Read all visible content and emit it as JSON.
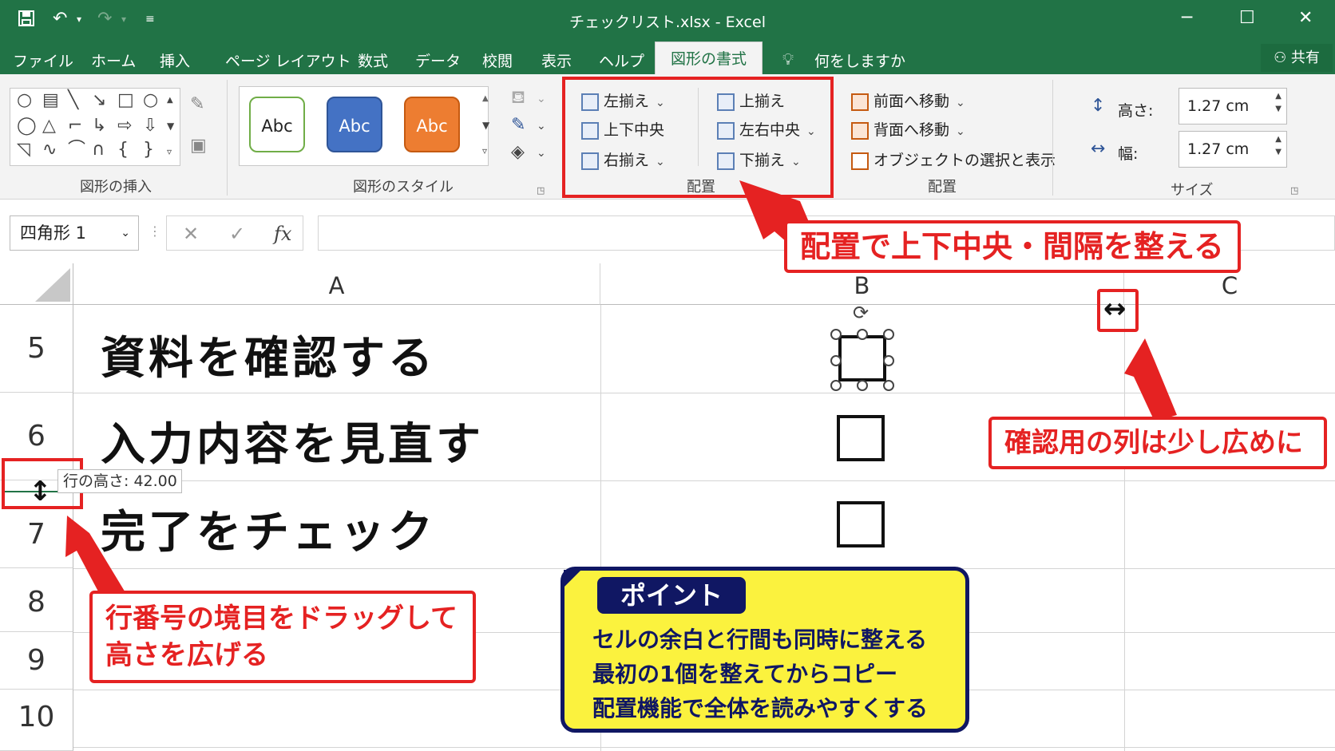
{
  "window": {
    "title": "チェックリスト.xlsx  -  Excel"
  },
  "titlebar": {
    "save_icon": "save-icon",
    "undo_icon": "undo-icon",
    "redo_icon": "redo-icon",
    "minimize": "─",
    "restore": "☐",
    "close": "✕"
  },
  "menu": {
    "items": [
      "ファイル",
      "ホーム",
      "挿入",
      "ページ レイアウト",
      "数式",
      "データ",
      "校閲",
      "表示",
      "ヘルプ"
    ],
    "active": "図形の書式",
    "search": "何をしますか",
    "share": "共有"
  },
  "ribbon": {
    "insert_shapes_label": "図形の挿入",
    "shape_styles_label": "図形のスタイル",
    "style_samples": [
      "Abc",
      "Abc",
      "Abc"
    ],
    "align": {
      "left": "左揃え",
      "middle": "上下中央",
      "right": "右揃え",
      "top": "上揃え",
      "center": "左右中央",
      "bottom": "下揃え",
      "label": "配置"
    },
    "arrange": {
      "bring_forward": "前面へ移動",
      "send_backward": "背面へ移動",
      "selection_pane": "オブジェクトの選択と表示",
      "label": "配置"
    },
    "size": {
      "height_label": "高さ:",
      "height_value": "1.27 cm",
      "width_label": "幅:",
      "width_value": "1.27 cm",
      "label": "サイズ"
    }
  },
  "formula_bar": {
    "name_box": "四角形 1",
    "cancel": "✕",
    "enter": "✓",
    "fx": "fx"
  },
  "columns": [
    "A",
    "B",
    "C"
  ],
  "rows": [
    {
      "num": "5",
      "text": "資料を確認する"
    },
    {
      "num": "6",
      "text": "入力内容を見直す"
    },
    {
      "num": "7",
      "text": "完了をチェック"
    },
    {
      "num": "8",
      "text": ""
    },
    {
      "num": "9",
      "text": ""
    },
    {
      "num": "10",
      "text": ""
    }
  ],
  "tooltip": "行の高さ: 42.00",
  "callouts": {
    "align": "配置で上下中央・間隔を整える",
    "column": "確認用の列は少し広めに",
    "row_line1": "行番号の境目をドラッグして",
    "row_line2": "高さを広げる"
  },
  "point": {
    "title": "ポイント",
    "lines": [
      "セルの余白と行間も同時に整える",
      "最初の1個を整えてからコピー",
      "配置機能で全体を読みやすくする"
    ]
  },
  "colors": {
    "excel_green": "#217346",
    "callout_red": "#e52222",
    "point_yellow": "#fbf23e",
    "point_navy": "#101763"
  }
}
